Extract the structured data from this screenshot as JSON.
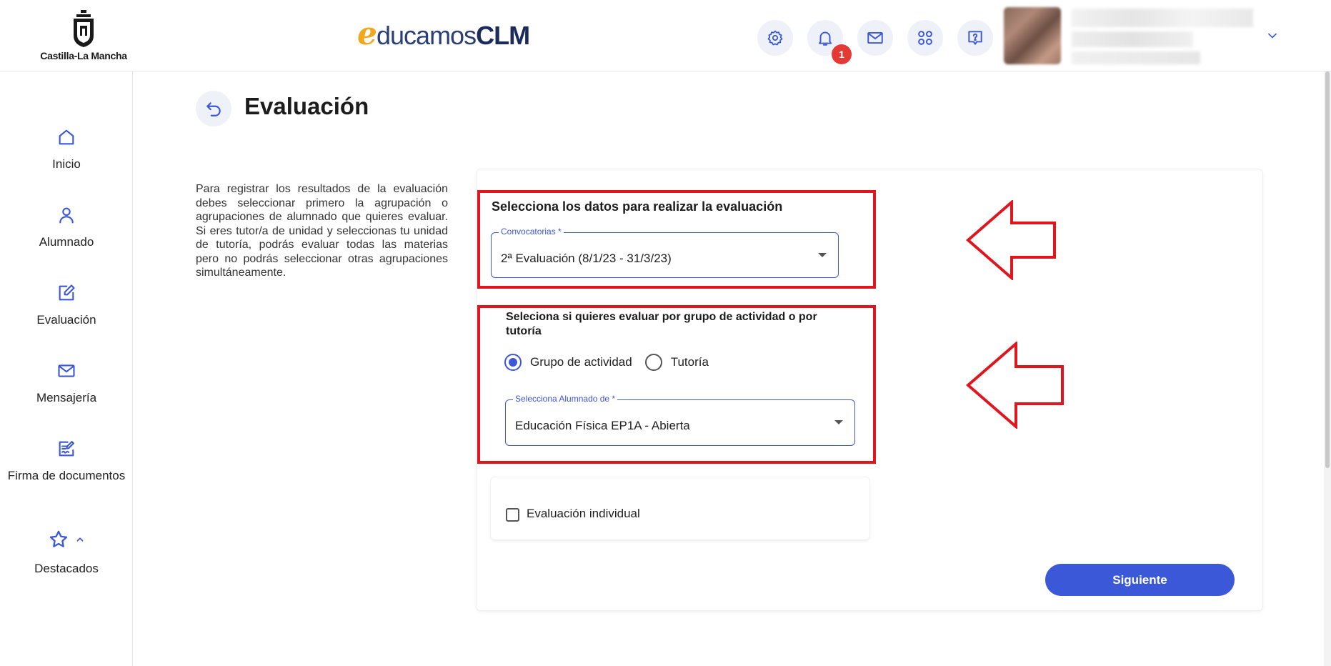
{
  "header": {
    "region_logo_text": "Castilla-La Mancha",
    "brand": {
      "e": "e",
      "mid": "ducamos",
      "suffix": "CLM"
    },
    "notification_count": "1",
    "icons": [
      "settings-icon",
      "bell-icon",
      "mail-icon",
      "apps-icon",
      "help-icon",
      "chevron-down-icon"
    ]
  },
  "sidebar": {
    "items": [
      {
        "label": "Inicio",
        "icon": "home-icon"
      },
      {
        "label": "Alumnado",
        "icon": "user-icon"
      },
      {
        "label": "Evaluación",
        "icon": "edit-icon"
      },
      {
        "label": "Mensajería",
        "icon": "mail-icon"
      },
      {
        "label": "Firma de documentos",
        "icon": "sign-document-icon"
      }
    ],
    "favorites_label": "Destacados"
  },
  "main": {
    "title": "Evaluación",
    "intro": "Para registrar los resultados de la evaluación debes seleccionar primero la agrupación o agrupaciones de alumnado que quieres evaluar. Si eres tutor/a de unidad y seleccionas tu unidad de tutoría, podrás evaluar todas las materias pero no podrás seleccionar otras agrupaciones simultáneamente.",
    "section1_title": "Selecciona los datos para realizar la evaluación",
    "convocatorias": {
      "label": "Convocatorias *",
      "value": "2ª Evaluación (8/1/23 - 31/3/23)"
    },
    "section2_title": "Seleciona si quieres evaluar por grupo de actividad o por tutoría",
    "radios": [
      {
        "label": "Grupo de actividad",
        "checked": true
      },
      {
        "label": "Tutoría",
        "checked": false
      }
    ],
    "alumnado": {
      "label": "Selecciona Alumnado de *",
      "value": "Educación Física EP1A - Abierta"
    },
    "individual_label": "Evaluación individual",
    "next_button": "Siguiente"
  },
  "colors": {
    "accent": "#3b58d9",
    "highlight_red": "#e0161f",
    "badge_red": "#e53935",
    "brand_orange": "#f2a81d",
    "brand_navy": "#1b2b5c"
  }
}
